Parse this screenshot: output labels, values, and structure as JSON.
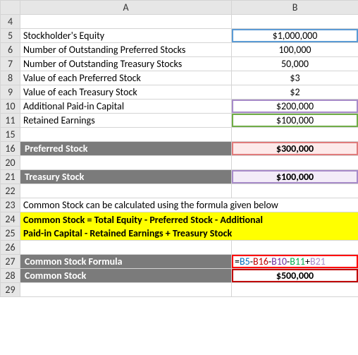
{
  "columns": {
    "rownum": "",
    "A": "A",
    "B": "B"
  },
  "rows": {
    "4": {
      "a": "",
      "b": ""
    },
    "5": {
      "a": "Stockholder's Equity",
      "b": "$1,000,000"
    },
    "6": {
      "a": "Number of Outstanding Preferred Stocks",
      "b": "100,000"
    },
    "7": {
      "a": "Number of Outstanding Treasury Stocks",
      "b": "50,000"
    },
    "8": {
      "a": "Value of each Preferred Stock",
      "b": "$3"
    },
    "9": {
      "a": "Value of each Treasury Stock",
      "b": "$2"
    },
    "10": {
      "a": "Additional Paid-in Capital",
      "b": "$200,000"
    },
    "11": {
      "a": "Retained Earnings",
      "b": "$100,000"
    },
    "15": {
      "a": "",
      "b": ""
    },
    "16": {
      "a": "Preferred Stock",
      "b": "$300,000"
    },
    "20": {
      "a": "",
      "b": ""
    },
    "21": {
      "a": "Treasury Stock",
      "b": "$100,000"
    },
    "22": {
      "a": "",
      "b": ""
    },
    "23": {
      "a": "Common Stock can be calculated using the formula given below",
      "b": ""
    },
    "24": {
      "a": "Common Stock = Total Equity - Preferred Stock - Additional",
      "b": ""
    },
    "25": {
      "a": "Paid-in Capital - Retained Earnings + Treasury Stock",
      "b": ""
    },
    "26": {
      "a": "",
      "b": ""
    },
    "27": {
      "a": "Common Stock Formula"
    },
    "28": {
      "a": "Common Stock",
      "b": "$500,000"
    },
    "29": {
      "a": "",
      "b": ""
    }
  },
  "formula": {
    "eq": "=",
    "b5": "B5",
    "m1": "-",
    "b16": "B16",
    "m2": "-",
    "b10": "B10",
    "m3": "-",
    "b11": "B11",
    "p1": "+",
    "b21": "B21"
  }
}
